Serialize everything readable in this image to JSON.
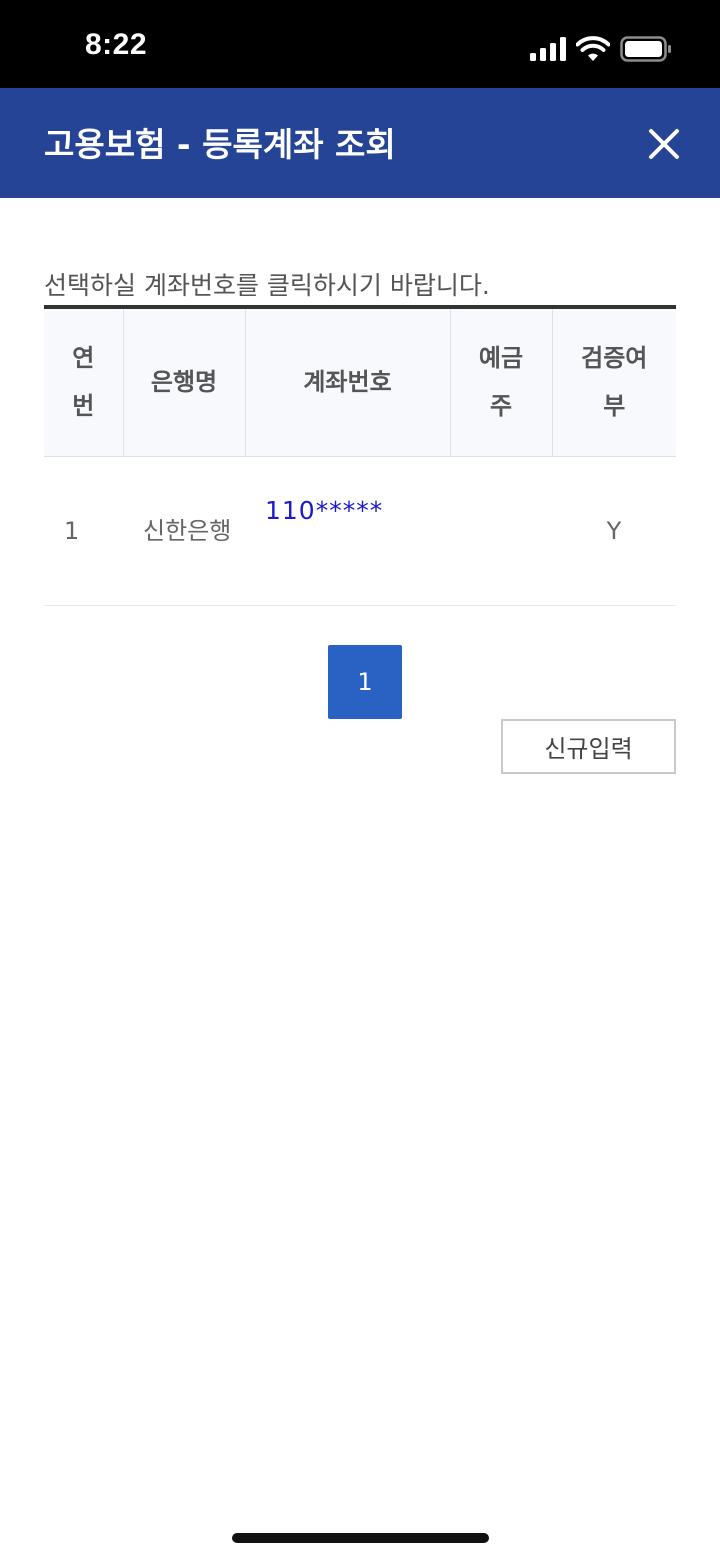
{
  "status_bar": {
    "time": "8:22"
  },
  "header": {
    "title": "고용보험 - 등록계좌 조회"
  },
  "instruction": "선택하실 계좌번호를 클릭하시기 바랍니다.",
  "table": {
    "headers": [
      "연번",
      "은행명",
      "계좌번호",
      "예금주",
      "검증여부"
    ],
    "rows": [
      {
        "num": "1",
        "bank": "신한은행",
        "account": "110*****",
        "holder": "",
        "verified": "Y"
      }
    ]
  },
  "pagination": {
    "current": "1"
  },
  "buttons": {
    "new_entry": "신규입력"
  },
  "colors": {
    "header_bg": "#264496",
    "page_btn": "#2a62c3",
    "link": "#1a1acc"
  }
}
